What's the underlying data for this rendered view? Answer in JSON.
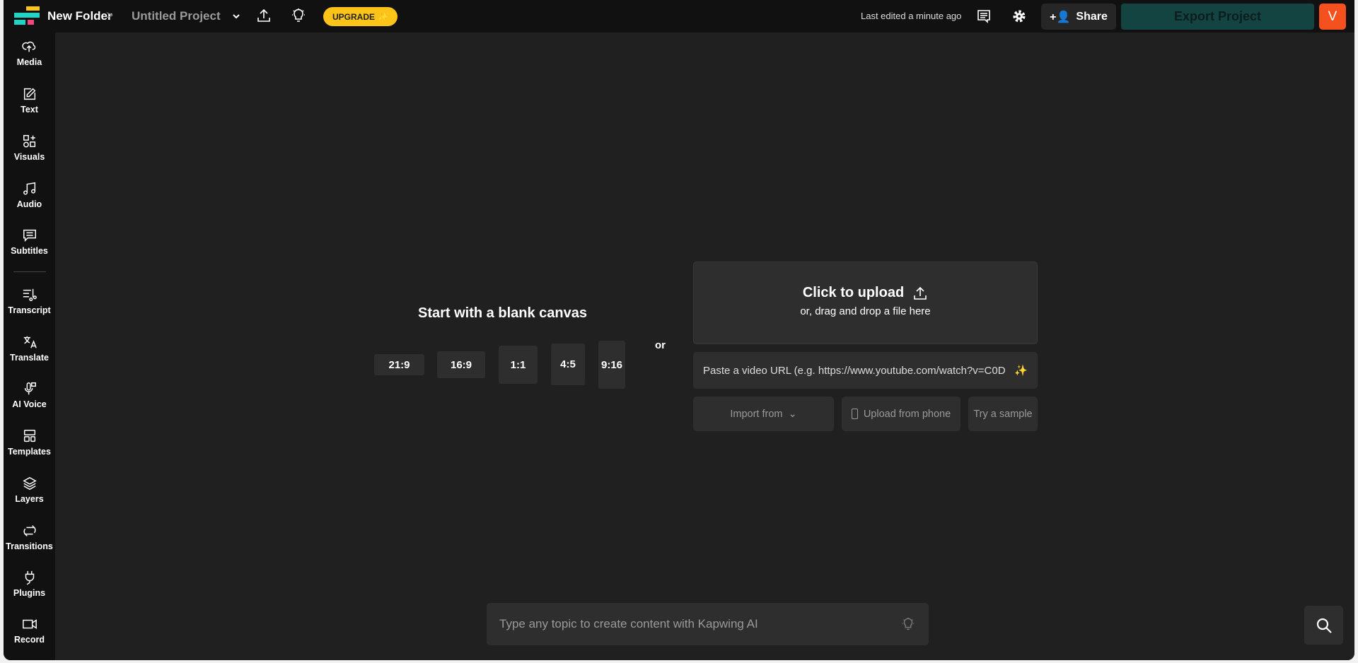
{
  "header": {
    "folder": "New Folder",
    "separator": ">",
    "project": "Untitled Project",
    "upgrade": "UPGRADE",
    "last_edited": "Last edited a minute ago",
    "share": "Share",
    "export": "Export Project",
    "avatar": "V"
  },
  "sidebar": {
    "items": [
      {
        "label": "Media",
        "icon": "cloud-upload-icon"
      },
      {
        "label": "Text",
        "icon": "edit-icon"
      },
      {
        "label": "Visuals",
        "icon": "shapes-icon"
      },
      {
        "label": "Audio",
        "icon": "music-icon"
      },
      {
        "label": "Subtitles",
        "icon": "subtitles-icon"
      },
      {
        "label": "Transcript",
        "icon": "transcript-icon"
      },
      {
        "label": "Translate",
        "icon": "translate-icon"
      },
      {
        "label": "AI Voice",
        "icon": "microphone-icon"
      },
      {
        "label": "Templates",
        "icon": "templates-icon"
      },
      {
        "label": "Layers",
        "icon": "layers-icon"
      },
      {
        "label": "Transitions",
        "icon": "transitions-icon"
      },
      {
        "label": "Plugins",
        "icon": "plug-icon"
      },
      {
        "label": "Record",
        "icon": "camera-icon"
      }
    ]
  },
  "main": {
    "blank_title": "Start with a blank canvas",
    "ratios": [
      "21:9",
      "16:9",
      "1:1",
      "4:5",
      "9:16"
    ],
    "or": "or",
    "upload_title": "Click to upload",
    "upload_sub": "or, drag and drop a file here",
    "url_placeholder": "Paste a video URL (e.g. https://www.youtube.com/watch?v=C0D",
    "import": "Import from",
    "phone": "Upload from phone",
    "sample": "Try a sample",
    "ai_placeholder": "Type any topic to create content with Kapwing AI"
  },
  "colors": {
    "upgrade": "#fcc419",
    "export": "#134441",
    "avatar": "#f4511e"
  }
}
